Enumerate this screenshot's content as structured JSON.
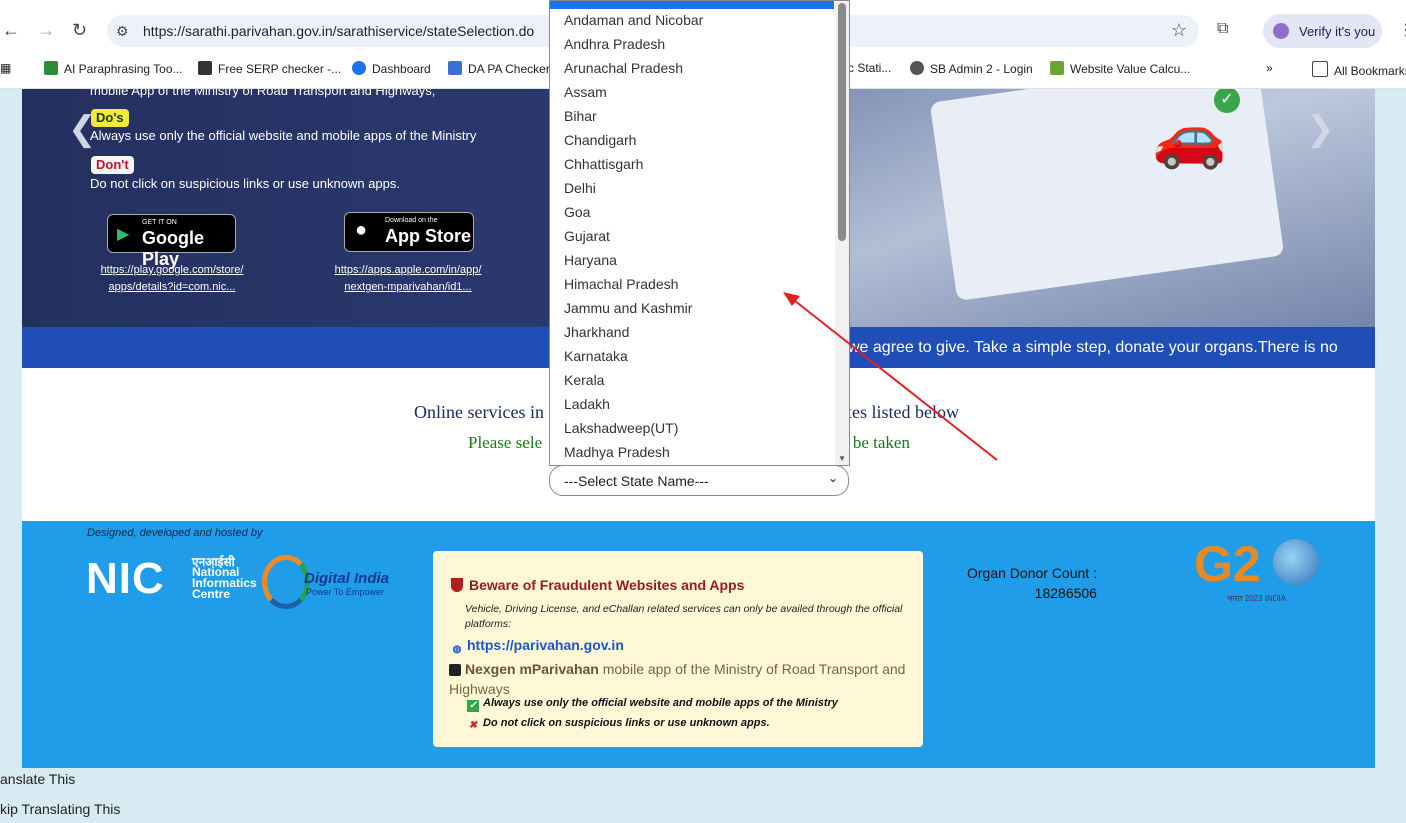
{
  "browser": {
    "url": "https://sarathi.parivahan.gov.in/sarathiservice/stateSelection.do",
    "verify_label": "Verify it's you",
    "bookmarks": [
      "AI Paraphrasing Too...",
      "Free SERP checker -...",
      "Dashboard",
      "DA PA Checker",
      "c Stati...",
      "SB Admin 2 - Login",
      "Website Value Calcu...",
      "All Bookmarks"
    ]
  },
  "banner": {
    "line_top": "mobile App of the Ministry of Road Transport and Highways,",
    "dos_tag": "Do's",
    "dos_text": "Always use only the official website and mobile apps of the Ministry",
    "donts_tag": "Don't",
    "donts_text": "Do not click on suspicious links or use unknown apps.",
    "google_small": "GET IT ON",
    "google_big": "Google Play",
    "apple_small": "Download on the",
    "apple_big": "App Store",
    "google_link_1": "https://play.google.com/store/",
    "google_link_2": "apps/details?id=com.nic...",
    "apple_link_1": "https://apps.apple.com/in/app/",
    "apple_link_2": "nextgen-mparivahan/id1..."
  },
  "ticker": {
    "text": "we agree to give. Take a simple step, donate your organs.There is no"
  },
  "main": {
    "line1_left": "Online services in",
    "line1_right": "tates listed below",
    "line2_left": "Please sele",
    "line2_right": "o be taken",
    "select_label": "---Select State Name---"
  },
  "dropdown": {
    "header": "---Select State Name---",
    "options": [
      "Andaman and Nicobar",
      "Andhra Pradesh",
      "Arunachal Pradesh",
      "Assam",
      "Bihar",
      "Chandigarh",
      "Chhattisgarh",
      "Delhi",
      "Goa",
      "Gujarat",
      "Haryana",
      "Himachal Pradesh",
      "Jammu and Kashmir",
      "Jharkhand",
      "Karnataka",
      "Kerala",
      "Ladakh",
      "Lakshadweep(UT)",
      "Madhya Pradesh"
    ]
  },
  "footer": {
    "designed": "Designed, developed and hosted by",
    "nic_hindi": "एनआईसी",
    "nic_name_1": "National",
    "nic_name_2": "Informatics",
    "nic_name_3": "Centre",
    "di_title": "Digital India",
    "di_tag": "Power To Empower",
    "warn_title": "Beware of Fraudulent Websites and Apps",
    "warn_sub": "Vehicle, Driving License, and eChallan related services can only be availed through the official platforms:",
    "warn_link": "https://parivahan.gov.in",
    "warn_app_bold": "Nexgen mParivahan",
    "warn_app_rest": " mobile app of the Ministry of Road Transport and Highways",
    "warn_ok": "Always use only the official website and mobile apps of the Ministry",
    "warn_no": "Do not click on suspicious links or use unknown apps.",
    "donor_label": "Organ Donor Count :",
    "donor_count": "18286506",
    "g20_sub": "भारत 2023 INDIA"
  },
  "translate": {
    "line1": "anslate This",
    "line2": "kip Translating This"
  },
  "colors": {
    "accent_blue": "#1f4fb6",
    "footer_blue": "#1f9de8",
    "annotation_red": "#e02020"
  }
}
